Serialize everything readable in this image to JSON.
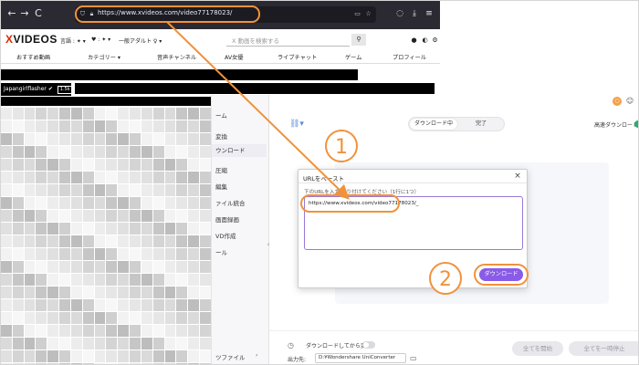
{
  "browser": {
    "back": "←",
    "forward": "→",
    "reload": "C",
    "url": "https://www.xvideos.com/video77178023/",
    "shield_icon": "shield-icon",
    "lock_icon": "lock-icon"
  },
  "site": {
    "logo_x": "X",
    "logo_rest": "VIDEOS",
    "lang": "言語 : ✦ ▾",
    "country": "♥ : ✦ ▾",
    "filter": "一般アダルト ♀ ▾",
    "search_placeholder": "X 動画を検索する",
    "nav": [
      "おすすめ動画",
      "カテゴリー ▾",
      "音声チャンネル",
      "AV女優",
      "ライブチャット",
      "ゲーム",
      "プロフィール"
    ]
  },
  "uploader": {
    "name": "Japangirlflasher",
    "tag": "1.5k"
  },
  "app": {
    "sidebar": [
      "ーム",
      "変換",
      "ウンロード",
      "圧縮",
      "編集",
      "ァイル統合",
      "画面録画",
      "VD作成",
      "ール",
      "ツファイル"
    ],
    "tabs": [
      "ダウンロード中",
      "完了"
    ],
    "high_speed": "高速ダウンロード",
    "badge": "○",
    "convert_after": "ダウンロードしてから変換",
    "output_label": "出力先:",
    "output_path": "D:¥Wondershare UniConverter",
    "start_all": "全てを開始",
    "pause_all": "全てを一時停止"
  },
  "dialog": {
    "title": "URLをペースト",
    "instruction": "下のURLを入力/貼り付けてください（1行に1つ）",
    "url": "https://www.xvideos.com/video77178023/_",
    "download": "ダウンロード"
  },
  "annotations": {
    "step1": "1",
    "step2": "2"
  },
  "colors": {
    "highlight": "#f0923b",
    "accent_purple": "#8a5be8",
    "logo_red": "#de2600",
    "toggle_green": "#21b36d"
  }
}
